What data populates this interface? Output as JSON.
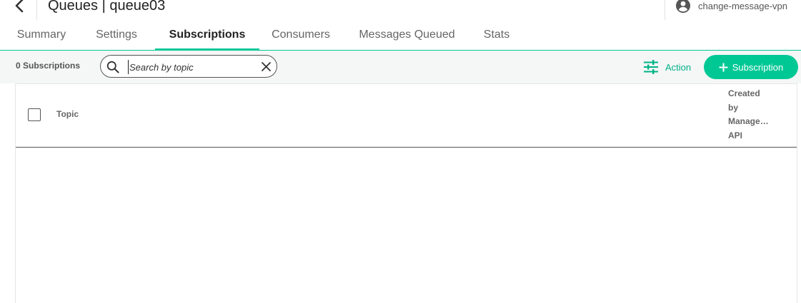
{
  "header": {
    "title": "Queues | queue03",
    "account_label": "change-message-vpn",
    "back_icon": "chevron-left-icon",
    "account_icon": "account-circle-icon"
  },
  "tabs": [
    {
      "label": "Summary",
      "active": false
    },
    {
      "label": "Settings",
      "active": false
    },
    {
      "label": "Subscriptions",
      "active": true
    },
    {
      "label": "Consumers",
      "active": false
    },
    {
      "label": "Messages Queued",
      "active": false
    },
    {
      "label": "Stats",
      "active": false
    }
  ],
  "toolbar": {
    "count_label": "0 Subscriptions",
    "search_placeholder": "Search by topic",
    "search_value": "",
    "action_label": "Action",
    "add_subscription_label": "Subscription"
  },
  "table": {
    "columns": {
      "topic": "Topic",
      "created_by_line1": "Created",
      "created_by_line2": "by",
      "created_by_line3": "Management",
      "created_by_line4": "API"
    },
    "rows": []
  },
  "colors": {
    "accent": "#00c895",
    "accent_text": "#00b386",
    "toolbar_bg": "#f5f6f6"
  }
}
